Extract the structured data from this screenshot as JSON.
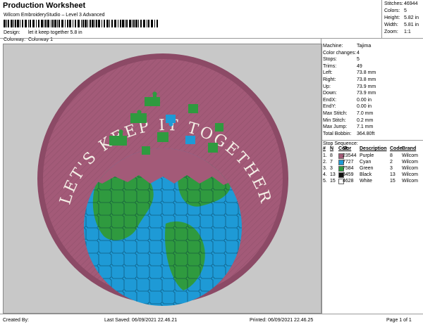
{
  "header": {
    "title": "Production Worksheet",
    "subtitle": "Wilcom EmbroideryStudio – Level 3 Advanced",
    "design_label": "Design:",
    "design_value": "let it keep together 5.8 in",
    "colorway_label": "Colorway:",
    "colorway_value": "Colorway 1"
  },
  "stats": {
    "stitches_label": "Stitches:",
    "stitches": "46944",
    "colors_label": "Colors:",
    "colors": "5",
    "height_label": "Height:",
    "height": "5.82 in",
    "width_label": "Width:",
    "width": "5.81 in",
    "zoom_label": "Zoom:",
    "zoom": "1:1"
  },
  "design": {
    "patch_text": "LET'S KEEP IT TOGETHER",
    "colors": {
      "purple": "#a35a78",
      "purple_dark": "#8c4a66",
      "cyan": "#1e9ad6",
      "green": "#2f9a3f",
      "white": "#f4efe6",
      "background": "#c8c8c8"
    }
  },
  "machine_panel": {
    "rows": [
      {
        "label": "Machine:",
        "value": "Tajima"
      },
      {
        "label": "Color changes:",
        "value": "4"
      },
      {
        "label": "Stops:",
        "value": "5"
      },
      {
        "label": "Trims:",
        "value": "49"
      },
      {
        "label": "Left:",
        "value": "73.8 mm"
      },
      {
        "label": "Right:",
        "value": "73.8 mm"
      },
      {
        "label": "Up:",
        "value": "73.9 mm"
      },
      {
        "label": "Down:",
        "value": "73.9 mm"
      },
      {
        "label": "EndX:",
        "value": "0.00 in"
      },
      {
        "label": "EndY:",
        "value": "0.00 in"
      },
      {
        "label": "Max Stitch:",
        "value": "7.0 mm"
      },
      {
        "label": "Min Stitch:",
        "value": "0.2 mm"
      },
      {
        "label": "Max Jump:",
        "value": "7.1 mm"
      },
      {
        "label": "Total Bobbin:",
        "value": "364.80ft"
      }
    ]
  },
  "stop_sequence": {
    "title": "Stop Sequence:",
    "headers": [
      "#",
      "N",
      "Color",
      "St.",
      "Description",
      "Code",
      "Brand"
    ],
    "rows": [
      {
        "num": "1.",
        "n": "8",
        "color": "#a35a78",
        "st": "23544",
        "desc": "Purple",
        "code": "8",
        "brand": "Wilcom"
      },
      {
        "num": "2.",
        "n": "7",
        "color": "#1e9ad6",
        "st": "7727",
        "desc": "Cyan",
        "code": "2",
        "brand": "Wilcom"
      },
      {
        "num": "3.",
        "n": "3",
        "color": "#2f9a3f",
        "st": "7584",
        "desc": "Green",
        "code": "3",
        "brand": "Wilcom"
      },
      {
        "num": "4.",
        "n": "13",
        "color": "#111111",
        "st": "3459",
        "desc": "Black",
        "code": "13",
        "brand": "Wilcom"
      },
      {
        "num": "5.",
        "n": "15",
        "color": "#ffffff",
        "st": "4628",
        "desc": "White",
        "code": "15",
        "brand": "Wilcom"
      }
    ]
  },
  "footer": {
    "created_by": "Created By:",
    "last_saved": "Last Saved: 06/09/2021 22.46.21",
    "printed": "Printed: 06/09/2021 22.46.25",
    "page": "Page 1 of 1"
  }
}
